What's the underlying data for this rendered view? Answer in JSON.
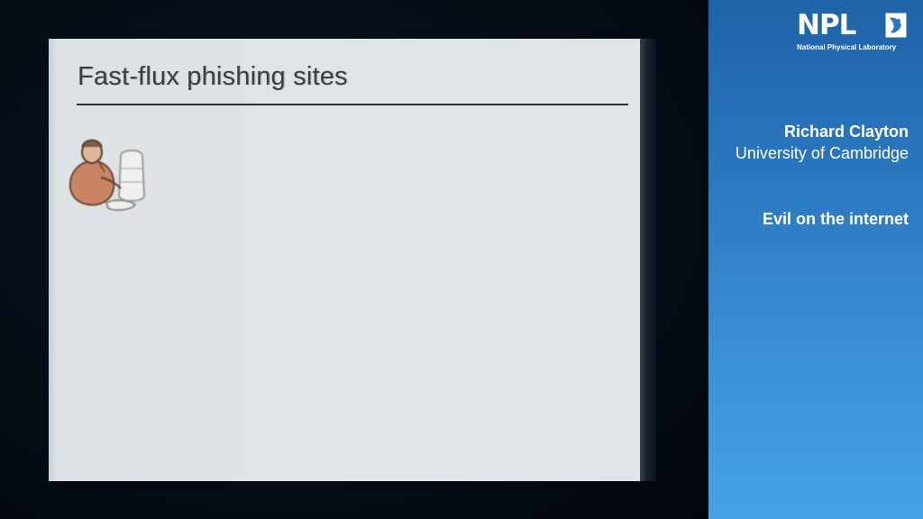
{
  "slide": {
    "title": "Fast-flux phishing sites",
    "clipart_icon": "person-with-bottle-clipart"
  },
  "sidebar": {
    "logo": {
      "letters": "NPL",
      "subtitle": "National Physical Laboratory",
      "badge_icon": "npl-crest-icon"
    },
    "speaker_name": "Richard Clayton",
    "speaker_affiliation": "University of Cambridge",
    "talk_title": "Evil on the internet"
  },
  "colors": {
    "sidebar_top": "#1f63a8",
    "sidebar_bottom": "#45a3e6",
    "slide_background": "#e0e5e7",
    "title_text": "#3a3f44",
    "background": "#000000"
  }
}
